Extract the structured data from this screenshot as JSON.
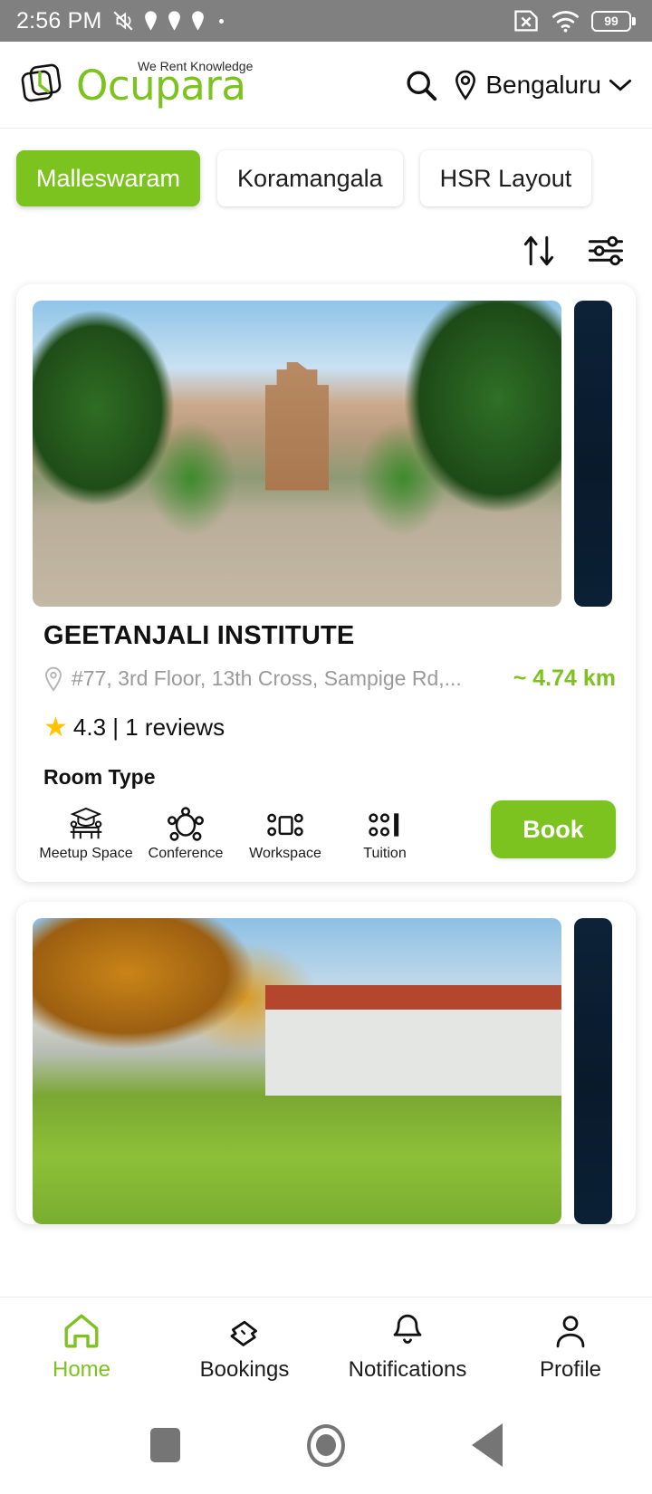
{
  "status_bar": {
    "time": "2:56 PM",
    "battery_level": "99",
    "icons": [
      "mute-icon",
      "location-pin-icon",
      "location-pin-icon",
      "location-pin-icon",
      "dot-icon",
      "sim-card-error-icon",
      "wifi-icon",
      "battery-icon"
    ]
  },
  "header": {
    "logo_name": "Ocupara",
    "logo_tagline": "We Rent Knowledge",
    "search_icon": "search-icon",
    "location_icon": "location-pin-icon",
    "city": "Bengaluru",
    "chevron_icon": "chevron-down-icon"
  },
  "filters": {
    "chips": [
      {
        "label": "Malleswaram",
        "active": true
      },
      {
        "label": "Koramangala",
        "active": false
      },
      {
        "label": "HSR Layout",
        "active": false
      }
    ],
    "sort_icon": "sort-arrows-icon",
    "filter_icon": "filter-sliders-icon"
  },
  "listings": [
    {
      "title": "GEETANJALI INSTITUTE",
      "address": "#77, 3rd Floor, 13th Cross, Sampige Rd,...",
      "address_icon": "location-pin-icon",
      "distance": "~ 4.74 km",
      "rating_value": "4.3",
      "rating_text": "4.3 | 1 reviews",
      "reviews": "1 reviews",
      "star_icon": "star-icon",
      "room_type_label": "Room Type",
      "room_types": [
        {
          "label": "Meetup Space",
          "icon": "graduation-meetup-icon"
        },
        {
          "label": "Conference",
          "icon": "conference-table-icon"
        },
        {
          "label": "Workspace",
          "icon": "workspace-desk-icon"
        },
        {
          "label": "Tuition",
          "icon": "tuition-classroom-icon"
        }
      ],
      "book_label": "Book"
    },
    {
      "title": "",
      "address": "",
      "distance": "",
      "rating_text": "",
      "room_type_label": "",
      "room_types": [],
      "book_label": ""
    }
  ],
  "bottom_nav": [
    {
      "label": "Home",
      "icon": "home-icon",
      "active": true
    },
    {
      "label": "Bookings",
      "icon": "ticket-icon",
      "active": false
    },
    {
      "label": "Notifications",
      "icon": "bell-icon",
      "active": false
    },
    {
      "label": "Profile",
      "icon": "person-icon",
      "active": false
    }
  ],
  "system_nav": {
    "recents_icon": "square-recents-icon",
    "home_icon": "circle-home-icon",
    "back_icon": "triangle-back-icon"
  },
  "colors": {
    "brand_green": "#7cc320",
    "star_yellow": "#ffc400",
    "status_bar_bg": "#808080",
    "muted_text": "#9a9a9a"
  }
}
